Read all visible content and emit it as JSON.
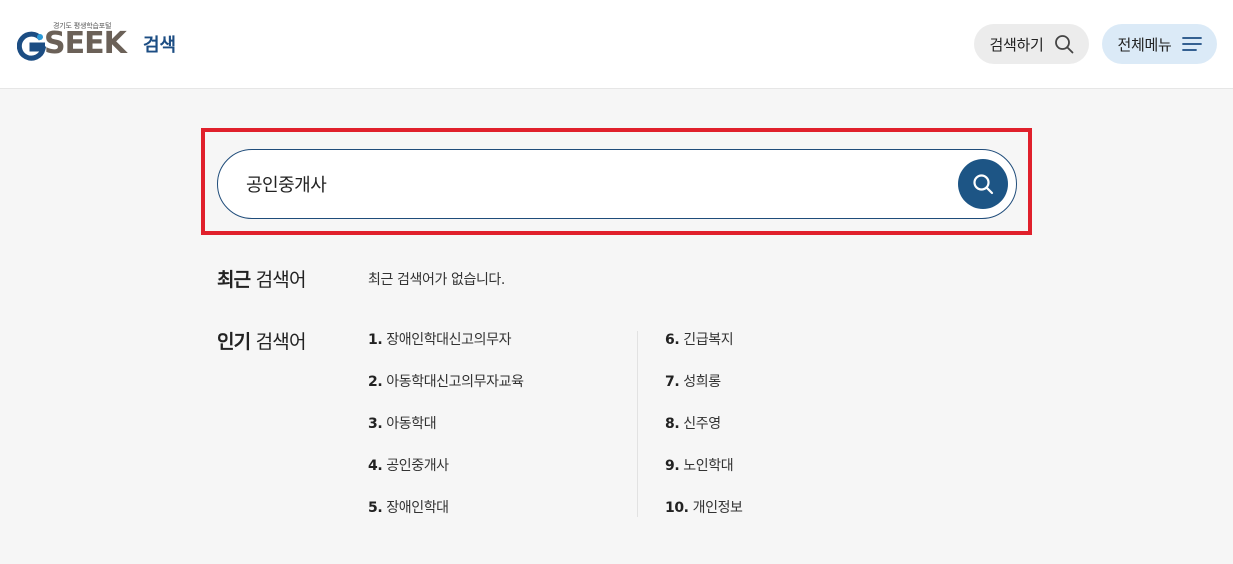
{
  "header": {
    "logo_subtitle": "경기도 평생학습포털",
    "logo_word": "SEEK",
    "logo_search": "검색",
    "search_button_label": "검색하기",
    "menu_button_label": "전체메뉴",
    "brand_color": "#1c4d83"
  },
  "search": {
    "value": "공인중개사",
    "placeholder": ""
  },
  "recent": {
    "title_bold": "최근",
    "title_rest": "검색어",
    "empty_text": "최근 검색어가 없습니다."
  },
  "popular": {
    "title_bold": "인기",
    "title_rest": "검색어",
    "left": [
      {
        "rank": "1.",
        "term": "장애인학대신고의무자"
      },
      {
        "rank": "2.",
        "term": "아동학대신고의무자교육"
      },
      {
        "rank": "3.",
        "term": "아동학대"
      },
      {
        "rank": "4.",
        "term": "공인중개사"
      },
      {
        "rank": "5.",
        "term": "장애인학대"
      }
    ],
    "right": [
      {
        "rank": "6.",
        "term": "긴급복지"
      },
      {
        "rank": "7.",
        "term": "성희롱"
      },
      {
        "rank": "8.",
        "term": "신주영"
      },
      {
        "rank": "9.",
        "term": "노인학대"
      },
      {
        "rank": "10.",
        "term": "개인정보"
      }
    ]
  }
}
